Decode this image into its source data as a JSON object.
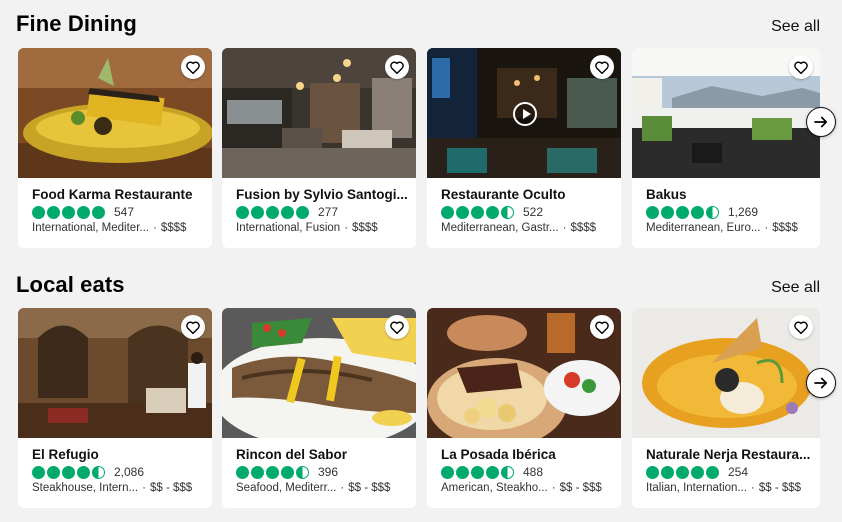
{
  "sections": [
    {
      "title": "Fine Dining",
      "see_all": "See all",
      "cards": [
        {
          "name": "Food Karma Restaurante",
          "rating": 5.0,
          "reviews": "547",
          "cuisine": "International, Mediter...",
          "price": "$$$$"
        },
        {
          "name": "Fusion by Sylvio Santogi...",
          "rating": 5.0,
          "reviews": "277",
          "cuisine": "International, Fusion",
          "price": "$$$$"
        },
        {
          "name": "Restaurante Oculto",
          "rating": 4.5,
          "reviews": "522",
          "cuisine": "Mediterranean, Gastr...",
          "price": "$$$$"
        },
        {
          "name": "Bakus",
          "rating": 4.5,
          "reviews": "1,269",
          "cuisine": "Mediterranean, Euro...",
          "price": "$$$$"
        }
      ]
    },
    {
      "title": "Local eats",
      "see_all": "See all",
      "cards": [
        {
          "name": "El Refugio",
          "rating": 4.5,
          "reviews": "2,086",
          "cuisine": "Steakhouse, Intern...",
          "price": "$$ - $$$"
        },
        {
          "name": "Rincon del Sabor",
          "rating": 4.5,
          "reviews": "396",
          "cuisine": "Seafood, Mediterr...",
          "price": "$$ - $$$"
        },
        {
          "name": "La Posada Ibérica",
          "rating": 4.5,
          "reviews": "488",
          "cuisine": "American, Steakho...",
          "price": "$$ - $$$"
        },
        {
          "name": "Naturale Nerja Restaura...",
          "rating": 5.0,
          "reviews": "254",
          "cuisine": "Italian, Internation...",
          "price": "$$ - $$$"
        }
      ]
    }
  ],
  "separator": "·",
  "icons": {
    "favorite": "heart-outline-icon",
    "next": "arrow-right-icon",
    "video": "play-icon"
  },
  "colors": {
    "bubble": "#00aa6c",
    "background": "#f2f2f2"
  }
}
